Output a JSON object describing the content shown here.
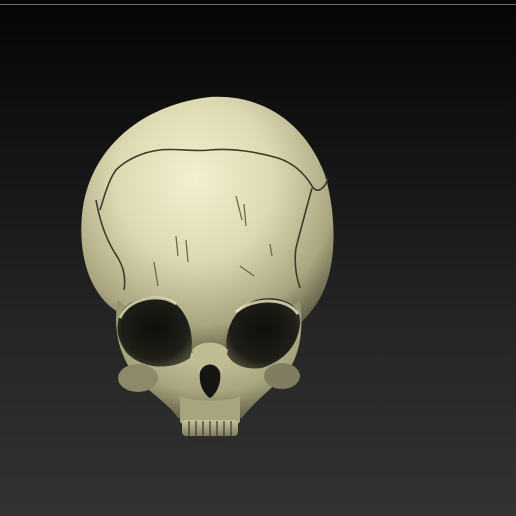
{
  "scene": {
    "subject": "skull-sculpt",
    "colors": {
      "background_top": "#050505",
      "background_bottom": "#323232",
      "bone_highlight": "#f2f0cf",
      "bone_mid": "#c9c69c",
      "bone_shadow": "#5c5a44",
      "cavity": "#141410"
    }
  }
}
